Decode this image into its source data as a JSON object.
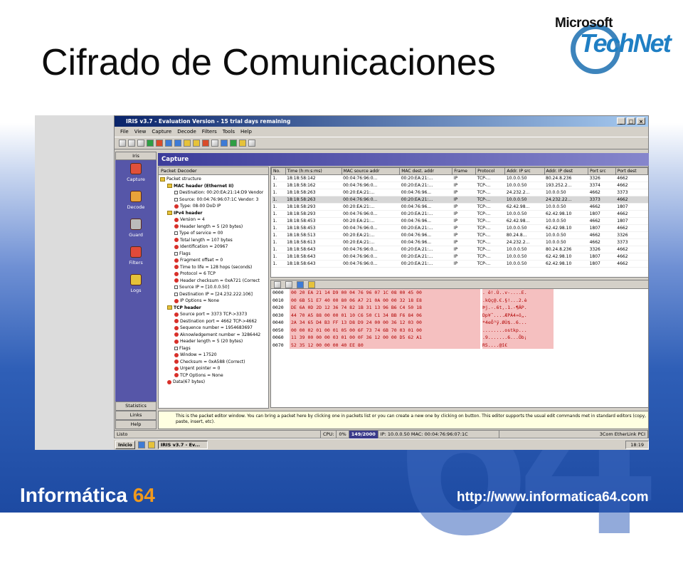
{
  "slide": {
    "title": "Cifrado de Comunicaciones",
    "logo_brand": "Microsoft",
    "logo_product": "TechNet",
    "footer_brand": "Informática",
    "footer_brand_number": "64",
    "footer_url": "http://www.informatica64.com",
    "background_number": "64"
  },
  "window": {
    "title": "IRIS v3.7 - Evaluation Version - 15 trial days remaining",
    "controls": [
      "_",
      "□",
      "×"
    ],
    "menu": [
      "File",
      "View",
      "Capture",
      "Decode",
      "Filters",
      "Tools",
      "Help"
    ]
  },
  "sidebar": {
    "header": "Iris",
    "items": [
      {
        "label": "Capture",
        "icon": "capture-icon"
      },
      {
        "label": "Decode",
        "icon": "decode-icon"
      },
      {
        "label": "Guard",
        "icon": "guard-icon"
      },
      {
        "label": "Filters",
        "icon": "filters-icon"
      },
      {
        "label": "Logs",
        "icon": "logs-icon"
      }
    ],
    "bottom": [
      "Statistics",
      "Links",
      "Help"
    ]
  },
  "capture": {
    "title": "Capture"
  },
  "decoder": {
    "title": "Packet Decoder",
    "tree": [
      {
        "t": "Packet structure",
        "lvl": 0,
        "k": "f"
      },
      {
        "t": "MAC header (Ethernet II)",
        "lvl": 1,
        "k": "f",
        "h": true
      },
      {
        "t": "Destination: 00:20:EA:21:14:D9 Vendor",
        "lvl": 2,
        "k": "b"
      },
      {
        "t": "Source: 00:04:76:96:07:1C Vendor: 3",
        "lvl": 2,
        "k": "b"
      },
      {
        "t": "Type: 08-00  DoD IP",
        "lvl": 2,
        "k": "d"
      },
      {
        "t": "IPv4 header",
        "lvl": 1,
        "k": "f",
        "h": true
      },
      {
        "t": "Version = 4",
        "lvl": 2,
        "k": "d"
      },
      {
        "t": "Header length = 5 (20 bytes)",
        "lvl": 2,
        "k": "d"
      },
      {
        "t": "Type of service = 00",
        "lvl": 2,
        "k": "b"
      },
      {
        "t": "Total length = 107 bytes",
        "lvl": 2,
        "k": "d"
      },
      {
        "t": "Identification = 20967",
        "lvl": 2,
        "k": "d"
      },
      {
        "t": "Flags",
        "lvl": 2,
        "k": "b"
      },
      {
        "t": "Fragment offset = 0",
        "lvl": 2,
        "k": "d"
      },
      {
        "t": "Time to life = 128 hops (seconds)",
        "lvl": 2,
        "k": "d"
      },
      {
        "t": "Protocol = 6  TCP",
        "lvl": 2,
        "k": "d"
      },
      {
        "t": "Header checksum = 0xA721 (Correct",
        "lvl": 2,
        "k": "d"
      },
      {
        "t": "Source  IP = [10.0.0.50]",
        "lvl": 2,
        "k": "b"
      },
      {
        "t": "Destination IP = [24.232.222.106]",
        "lvl": 2,
        "k": "b"
      },
      {
        "t": "IP Options = None",
        "lvl": 2,
        "k": "d"
      },
      {
        "t": "TCP header",
        "lvl": 1,
        "k": "f",
        "h": true
      },
      {
        "t": "Source port = 3373 TCP->3373",
        "lvl": 2,
        "k": "d"
      },
      {
        "t": "Destination port = 4662 TCP->4662",
        "lvl": 2,
        "k": "d"
      },
      {
        "t": "Sequence number = 1954683697",
        "lvl": 2,
        "k": "d"
      },
      {
        "t": "Aknowledgement number = 3286442",
        "lvl": 2,
        "k": "d"
      },
      {
        "t": "Header length = 5 (20 bytes)",
        "lvl": 2,
        "k": "d"
      },
      {
        "t": "Flags",
        "lvl": 2,
        "k": "b"
      },
      {
        "t": "Window = 17520",
        "lvl": 2,
        "k": "d"
      },
      {
        "t": "Checksum = 0xA588  (Correct)",
        "lvl": 2,
        "k": "d"
      },
      {
        "t": "Urgent pointer = 0",
        "lvl": 2,
        "k": "d"
      },
      {
        "t": "TCP Options = None",
        "lvl": 2,
        "k": "d"
      },
      {
        "t": "Data(67 bytes)",
        "lvl": 1,
        "k": "d"
      }
    ]
  },
  "packets": {
    "columns": [
      "No.",
      "Time (h:m:s:ms)",
      "MAC source addr",
      "MAC dest. addr",
      "Frame",
      "Protocol",
      "Addr. IP src",
      "Addr. IP dest",
      "Port src",
      "Port dest"
    ],
    "selected_row": 3,
    "rows": [
      [
        "1.",
        "18:18:58:142",
        "00:04:76:96:0...",
        "00:20:EA:21:...",
        "IP",
        "TCP-...",
        "10.0.0.50",
        "80.24.8.236",
        "3326",
        "4662"
      ],
      [
        "1.",
        "18:18:58:162",
        "00:04:76:96:0...",
        "00:20:EA:21:...",
        "IP",
        "TCP-...",
        "10.0.0.50",
        "193.252.2...",
        "3374",
        "4662"
      ],
      [
        "1.",
        "18:18:58:263",
        "00:20:EA:21:...",
        "00:04:76:96...",
        "IP",
        "TCP-...",
        "24.232.2...",
        "10.0.0.50",
        "4662",
        "3373"
      ],
      [
        "1.",
        "18:18:58:263",
        "00:04:76:96:0...",
        "00:20:EA:21:...",
        "IP",
        "TCP-...",
        "10.0.0.50",
        "24.232.22...",
        "3373",
        "4662"
      ],
      [
        "1.",
        "18:18:58:293",
        "00:20:EA:21:...",
        "00:04:76:96...",
        "IP",
        "TCP-...",
        "62.42.98...",
        "10.0.0.50",
        "4662",
        "1807"
      ],
      [
        "1.",
        "18:18:58:293",
        "00:04:76:96:0...",
        "00:20:EA:21:...",
        "IP",
        "TCP-...",
        "10.0.0.50",
        "62.42.98.10",
        "1807",
        "4662"
      ],
      [
        "1.",
        "18:18:58:453",
        "00:20:EA:21:...",
        "00:04:76:96...",
        "IP",
        "TCP-...",
        "62.42.98...",
        "10.0.0.50",
        "4662",
        "1807"
      ],
      [
        "1.",
        "18:18:58:453",
        "00:04:76:96:0...",
        "00:20:EA:21:...",
        "IP",
        "TCP-...",
        "10.0.0.50",
        "62.42.98.10",
        "1807",
        "4662"
      ],
      [
        "1.",
        "18:18:58:513",
        "00:20:EA:21:...",
        "00:04:76:96...",
        "IP",
        "TCP-...",
        "80.24.8...",
        "10.0.0.50",
        "4662",
        "3326"
      ],
      [
        "1.",
        "18:18:58:613",
        "00:20:EA:21:...",
        "00:04:76:96...",
        "IP",
        "TCP-...",
        "24.232.2...",
        "10.0.0.50",
        "4662",
        "3373"
      ],
      [
        "1.",
        "18:18:58:643",
        "00:04:76:96:0...",
        "00:20:EA:21:...",
        "IP",
        "TCP-...",
        "10.0.0.50",
        "80.24.8.236",
        "3326",
        "4662"
      ],
      [
        "1.",
        "18:18:58:643",
        "00:04:76:96:0...",
        "00:20:EA:21:...",
        "IP",
        "TCP-...",
        "10.0.0.50",
        "62.42.98.10",
        "1807",
        "4662"
      ],
      [
        "1.",
        "18:18:58:643",
        "00:04:76:96:0...",
        "00:20:EA:21:...",
        "IP",
        "TCP-...",
        "10.0.0.50",
        "62.42.98.10",
        "1807",
        "4662"
      ]
    ]
  },
  "hex": {
    "rows": [
      [
        "0000",
        "00 20 EA 21 14 D9 00 04 76 96 07 1C 08 00 45 00",
        ". ê!.Ù..v-....E."
      ],
      [
        "0010",
        "00 6B 51 E7 40 00 80 06 A7 21 0A 00 00 32 18 E8",
        ".kQç@.€.§!...2.è"
      ],
      [
        "0020",
        "DE 6A 0D 2D 12 36 74 82 1B 31 13 96 B6 C4 50 18",
        "Þj.-.6t,.1.-¶ÄP."
      ],
      [
        "0030",
        "44 70 A5 88 00 00 01 10 C6 50 C1 34 BB F6 84 06",
        "Dp¥ˆ....ÆPÁ4»ö„."
      ],
      [
        "0040",
        "2A 34 65 D4 B3 FF 13 D8 D9 24 00 00 36 12 03 00",
        "*4eÔ³ÿ.ØÙ$..6..."
      ],
      [
        "0050",
        "00 00 02 01 00 01 05 00 6F 73 74 6B 70 03 01 00",
        "........ostkp..."
      ],
      [
        "0060",
        "11 39 00 00 00 03 01 00 0F 36 12 00 00 D5 62 A1",
        ".9.......6...Õb¡"
      ],
      [
        "0070",
        "52 35 12 00 00 00 40 EE 80",
        "R5....@î€"
      ]
    ]
  },
  "info_text": "This is the packet editor window. You can bring a packet here by clicking one in packets list or you can create a new one by clicking on  button. This editor supports the usual edit commands met in standard editors (copy, paste, insert, etc).",
  "status": {
    "ready": "Listo",
    "cpu_label": "CPU:",
    "cpu": "0%",
    "count": "149/2000",
    "ip_info": "IP: 10.0.0.50 MAC: 00:04:76:96:07:1C",
    "adapter": "3Com EtherLink PCI"
  },
  "taskbar": {
    "start": "Inicio",
    "task": "IRIS v3.7 - Ev...",
    "clock": "18:19"
  }
}
